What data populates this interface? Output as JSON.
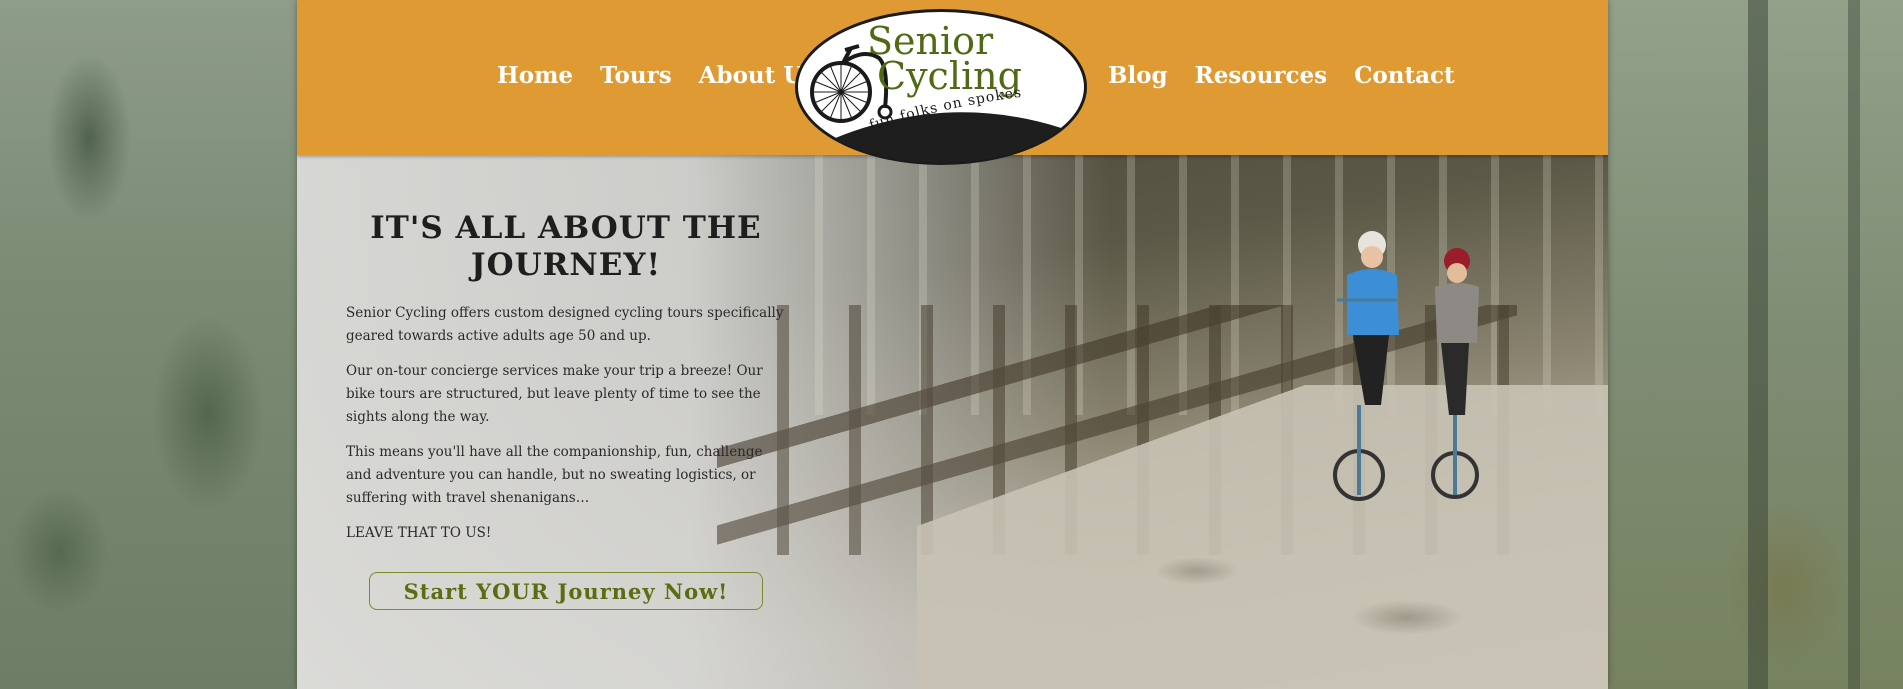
{
  "nav": {
    "left": [
      "Home",
      "Tours",
      "About Us"
    ],
    "right": [
      "Blog",
      "Resources",
      "Contact"
    ]
  },
  "logo": {
    "line1": "Senior",
    "line2": "Cycling",
    "tagline": "fun folks on spokes"
  },
  "hero": {
    "title": "IT'S ALL ABOUT THE JOURNEY!",
    "paragraphs": [
      "Senior Cycling offers custom designed cycling tours specifically geared towards active adults age 50 and up.",
      "Our on-tour concierge services make your trip a breeze! Our bike tours are structured, but leave plenty of time to see the sights along the way.",
      "This means you'll have all the companionship, fun, challenge and adventure you can handle, but no sweating logistics, or suffering with travel shenanigans…",
      "LEAVE THAT TO US!"
    ],
    "cta": "Start YOUR Journey Now!"
  },
  "colors": {
    "header": "#e09a33",
    "logo_green": "#4f6a14",
    "cta_green": "#5a6d12"
  }
}
